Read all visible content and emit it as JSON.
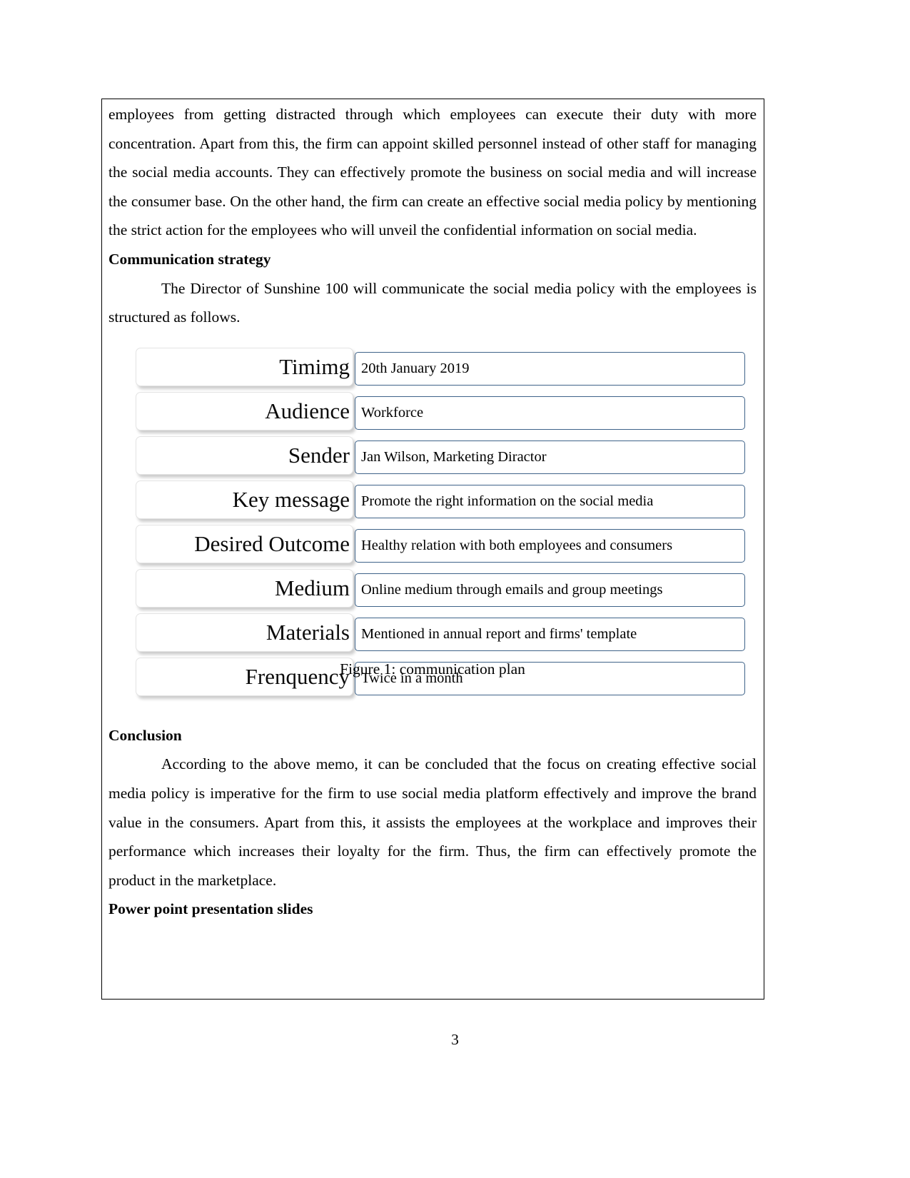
{
  "document": {
    "page_number": "3",
    "paragraph_1": "employees from getting distracted through which employees can execute their duty with more concentration. Apart from this, the firm can appoint skilled personnel instead of other staff for managing the social media accounts. They can effectively promote the business on social media and will increase the consumer base.  On the other hand, the firm can create an effective social media policy by mentioning the strict action for the employees who will unveil the confidential information on social media.",
    "heading_communication_strategy": "Communication strategy",
    "paragraph_2": "The Director of Sunshine 100 will communicate the social media policy with the employees is structured as follows.",
    "heading_conclusion": "Conclusion",
    "paragraph_conclusion": "According to the above memo, it can be concluded that the focus on creating effective social media policy is imperative for the firm to use social media platform effectively and improve the brand value in the consumers. Apart from this, it assists the employees at the workplace and improves their performance which increases their loyalty for the firm. Thus, the firm can effectively promote the product in the marketplace.",
    "heading_ppt_slides": "Power point presentation slides"
  },
  "figure": {
    "caption": "Figure 1: communication plan",
    "border_color": "#3f6389",
    "rows": [
      {
        "label": "Timimg",
        "value": "20th January 2019"
      },
      {
        "label": "Audience",
        "value": "Workforce"
      },
      {
        "label": "Sender",
        "value": "Jan Wilson, Marketing Diractor"
      },
      {
        "label": "Key message",
        "value": " Promote the  right information on the social media"
      },
      {
        "label": "Desired Outcome",
        "value": "Healthy relation with both employees and consumers"
      },
      {
        "label": "Medium",
        "value": "Online medium through emails and group meetings"
      },
      {
        "label": "Materials",
        "value": "Mentioned in annual report and firms' template"
      },
      {
        "label": "Frenquency",
        "value": "Twice in a month"
      }
    ]
  }
}
